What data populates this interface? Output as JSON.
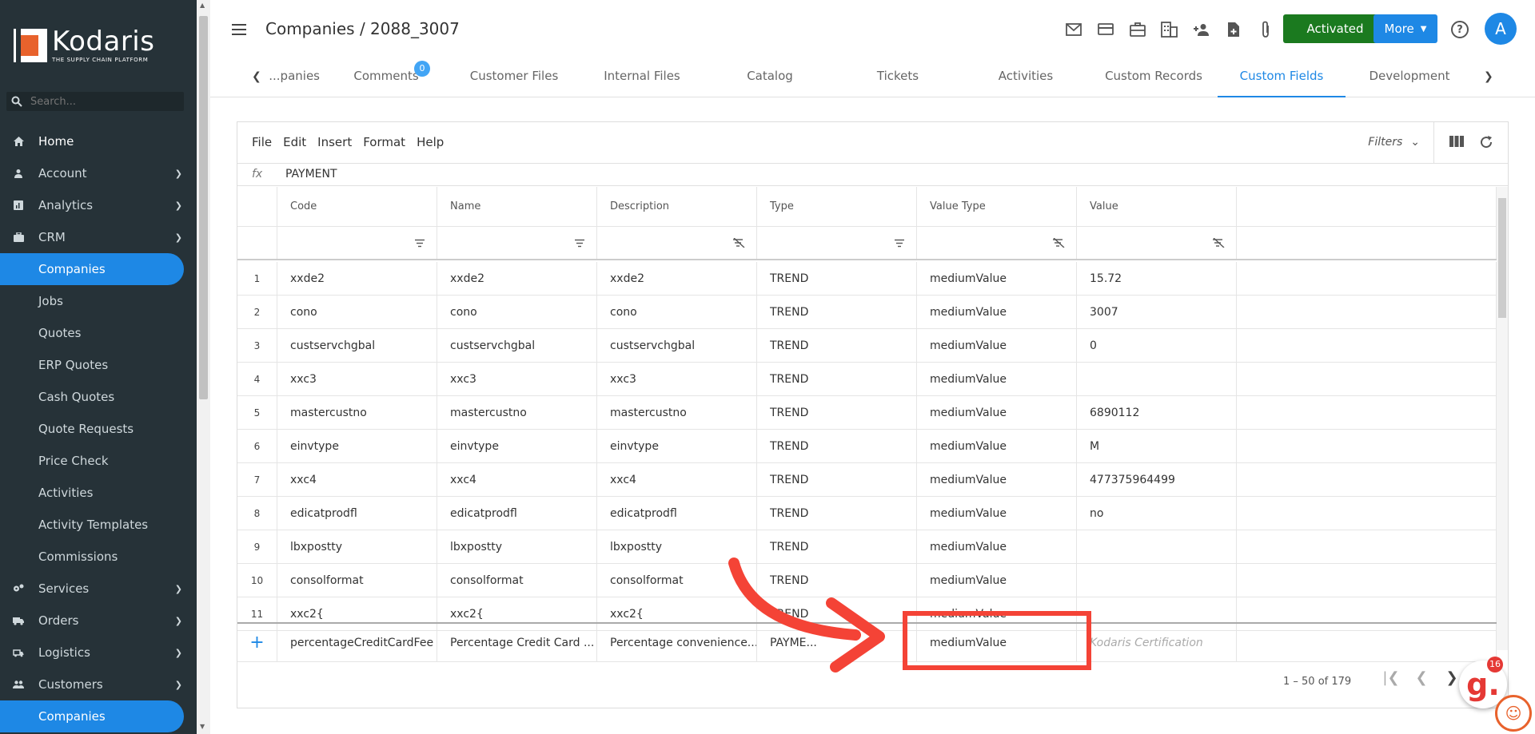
{
  "brand": {
    "name": "Kodaris",
    "tagline": "THE SUPPLY CHAIN PLATFORM"
  },
  "search": {
    "placeholder": "Search..."
  },
  "sidebar": {
    "items": [
      {
        "label": "Home",
        "icon": "home-icon"
      },
      {
        "label": "Account",
        "icon": "person-icon"
      },
      {
        "label": "Analytics",
        "icon": "chart-icon"
      },
      {
        "label": "CRM",
        "icon": "briefcase-icon"
      },
      {
        "label": "Companies"
      },
      {
        "label": "Jobs"
      },
      {
        "label": "Quotes"
      },
      {
        "label": "ERP Quotes"
      },
      {
        "label": "Cash Quotes"
      },
      {
        "label": "Quote Requests"
      },
      {
        "label": "Price Check"
      },
      {
        "label": "Activities"
      },
      {
        "label": "Activity Templates"
      },
      {
        "label": "Commissions"
      },
      {
        "label": "Services",
        "icon": "gears-icon"
      },
      {
        "label": "Orders",
        "icon": "truck-icon"
      },
      {
        "label": "Logistics",
        "icon": "shipping-icon"
      },
      {
        "label": "Customers",
        "icon": "people-icon"
      },
      {
        "label": "Companies"
      }
    ]
  },
  "header": {
    "title": "Companies / 2088_3007",
    "activated_label": "Activated",
    "more_label": "More",
    "avatar_initial": "A",
    "colors": {
      "activated": "#1b7a1f",
      "primary": "#1e88e5"
    }
  },
  "tabs": [
    {
      "label": "...panies"
    },
    {
      "label": "Comments",
      "badge": "0"
    },
    {
      "label": "Customer Files"
    },
    {
      "label": "Internal Files"
    },
    {
      "label": "Catalog"
    },
    {
      "label": "Tickets"
    },
    {
      "label": "Activities"
    },
    {
      "label": "Custom Records"
    },
    {
      "label": "Custom Fields"
    },
    {
      "label": "Development"
    }
  ],
  "grid": {
    "menu": [
      "File",
      "Edit",
      "Insert",
      "Format",
      "Help"
    ],
    "filters_label": "Filters",
    "fx_label": "fx",
    "formula_value": "PAYMENT",
    "columns": [
      "Code",
      "Name",
      "Description",
      "Type",
      "Value Type",
      "Value"
    ],
    "rows": [
      [
        "1",
        "xxde2",
        "xxde2",
        "xxde2",
        "TREND",
        "mediumValue",
        "15.72"
      ],
      [
        "2",
        "cono",
        "cono",
        "cono",
        "TREND",
        "mediumValue",
        "3007"
      ],
      [
        "3",
        "custservchgbal",
        "custservchgbal",
        "custservchgbal",
        "TREND",
        "mediumValue",
        "0"
      ],
      [
        "4",
        "xxc3",
        "xxc3",
        "xxc3",
        "TREND",
        "mediumValue",
        ""
      ],
      [
        "5",
        "mastercustno",
        "mastercustno",
        "mastercustno",
        "TREND",
        "mediumValue",
        "6890112"
      ],
      [
        "6",
        "einvtype",
        "einvtype",
        "einvtype",
        "TREND",
        "mediumValue",
        "M"
      ],
      [
        "7",
        "xxc4",
        "xxc4",
        "xxc4",
        "TREND",
        "mediumValue",
        "477375964499"
      ],
      [
        "8",
        "edicatprodfl",
        "edicatprodfl",
        "edicatprodfl",
        "TREND",
        "mediumValue",
        "no"
      ],
      [
        "9",
        "lbxpostty",
        "lbxpostty",
        "lbxpostty",
        "TREND",
        "mediumValue",
        ""
      ],
      [
        "10",
        "consolformat",
        "consolformat",
        "consolformat",
        "TREND",
        "mediumValue",
        ""
      ],
      [
        "11",
        "xxc2{",
        "xxc2{",
        "xxc2{",
        "TREND",
        "mediumValue",
        ""
      ]
    ],
    "new_row": {
      "code": "percentageCreditCardFee",
      "name": "Percentage Credit Card ...",
      "description": "Percentage convenience...",
      "type": "PAYME...",
      "value_type": "mediumValue",
      "value_placeholder": "Kodaris Certification"
    },
    "pager": "1 – 50 of 179"
  },
  "widget": {
    "badge": "16",
    "letter": "g."
  }
}
